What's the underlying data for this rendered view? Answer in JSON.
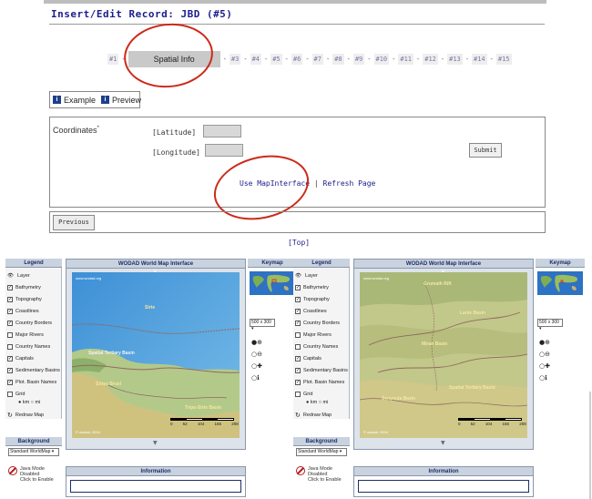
{
  "editor": {
    "title": "Insert/Edit Record: JBD (#5)",
    "steps": [
      "#1",
      "Spatial Info",
      "#3",
      "#4",
      "#5",
      "#6",
      "#7",
      "#8",
      "#9",
      "#10",
      "#11",
      "#12",
      "#13",
      "#14",
      "#15"
    ],
    "active_step": "Spatial Info",
    "step_separator": "-",
    "tabs": [
      {
        "label": "Example",
        "icon": "info-icon"
      },
      {
        "label": "Preview",
        "icon": "info-icon"
      }
    ],
    "coordinates_label": "Coordinates",
    "coordinates_marker": "*",
    "latitude_label": "[Latitude]",
    "longitude_label": "[Longitude]",
    "latitude_value": "",
    "longitude_value": "",
    "submit_label": "Submit",
    "map_link": "Use MapInterface",
    "link_separator": "|",
    "refresh_link": "Refresh Page",
    "previous_label": "Previous",
    "top_link": "[Top]",
    "annotation_color": "#cc2a1a"
  },
  "map_left": {
    "legend_title": "Legend",
    "map_title": "WODAD World Map Interface",
    "keymap_title": "Keymap",
    "background_title": "Background",
    "information_title": "Information",
    "layer_header": "Layer",
    "layers": [
      {
        "label": "Bathymetry",
        "checked": true
      },
      {
        "label": "Topography",
        "checked": true
      },
      {
        "label": "Coastlines",
        "checked": true
      },
      {
        "label": "Country Borders",
        "checked": true
      },
      {
        "label": "Major Rivers",
        "checked": false
      },
      {
        "label": "Country Names",
        "checked": false
      },
      {
        "label": "Capitals",
        "checked": true
      },
      {
        "label": "Sedimentary Basins",
        "checked": true
      },
      {
        "label": "Plot. Basin Names",
        "checked": true
      },
      {
        "label": "Grid",
        "checked": false
      }
    ],
    "units": "● km ○ mi",
    "redraw_label": "Redraw Map",
    "background_value": "Standard WorldMap",
    "java_line1": "Java Mode Disabled",
    "java_line2": "Click to Enable",
    "size_value": "500 x 300",
    "watermark": "www.wodad.org",
    "copyright": "© wodad. 2004",
    "scale_ticks": [
      "0",
      "52",
      "104",
      "156",
      "208 km"
    ],
    "map_labels": [
      "Sirte",
      "Spatial Tertiary Basin",
      "Sirtes Bruel",
      "Tripo-Sirte Basin"
    ]
  },
  "map_right": {
    "legend_title": "Legend",
    "map_title": "WODAD World Map Interface",
    "keymap_title": "Keymap",
    "background_title": "Background",
    "information_title": "Information",
    "layer_header": "Layer",
    "layers": [
      {
        "label": "Bathymetry",
        "checked": true
      },
      {
        "label": "Topography",
        "checked": true
      },
      {
        "label": "Coastlines",
        "checked": true
      },
      {
        "label": "Country Borders",
        "checked": true
      },
      {
        "label": "Major Rivers",
        "checked": false
      },
      {
        "label": "Country Names",
        "checked": false
      },
      {
        "label": "Capitals",
        "checked": true
      },
      {
        "label": "Sedimentary Basins",
        "checked": true
      },
      {
        "label": "Plot. Basin Names",
        "checked": true
      },
      {
        "label": "Grid",
        "checked": false
      }
    ],
    "units": "● km ○ mi",
    "redraw_label": "Redraw Map",
    "background_value": "Standard WorldMap",
    "java_line1": "Java Mode Disabled",
    "java_line2": "Click to Enable",
    "size_value": "500 x 300",
    "watermark": "www.wodad.org",
    "copyright": "© wodad. 2004",
    "scale_ticks": [
      "0",
      "52",
      "104",
      "156",
      "208 km"
    ],
    "map_labels": [
      "Grumath Rift",
      "Lanle Basin",
      "Miran Basin",
      "Spatial Tertiary Basin",
      "Senyoula Basin"
    ]
  }
}
